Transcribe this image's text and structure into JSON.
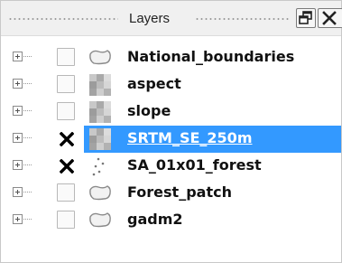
{
  "panel": {
    "title": "Layers"
  },
  "layers": [
    {
      "name": "National_boundaries",
      "checked": false,
      "icon": "polygon-layer-icon",
      "selected": false
    },
    {
      "name": "aspect",
      "checked": false,
      "icon": "raster-layer-icon",
      "selected": false
    },
    {
      "name": "slope",
      "checked": false,
      "icon": "raster-layer-icon",
      "selected": false
    },
    {
      "name": "SRTM_SE_250m",
      "checked": true,
      "icon": "raster-layer-icon",
      "selected": true
    },
    {
      "name": "SA_01x01_forest",
      "checked": true,
      "icon": "point-layer-icon",
      "selected": false
    },
    {
      "name": "Forest_patch",
      "checked": false,
      "icon": "polygon-layer-icon",
      "selected": false
    },
    {
      "name": "gadm2",
      "checked": false,
      "icon": "polygon-layer-icon",
      "selected": false
    }
  ],
  "colors": {
    "selection": "#3399ff",
    "titlebar": "#f0f0f0"
  }
}
